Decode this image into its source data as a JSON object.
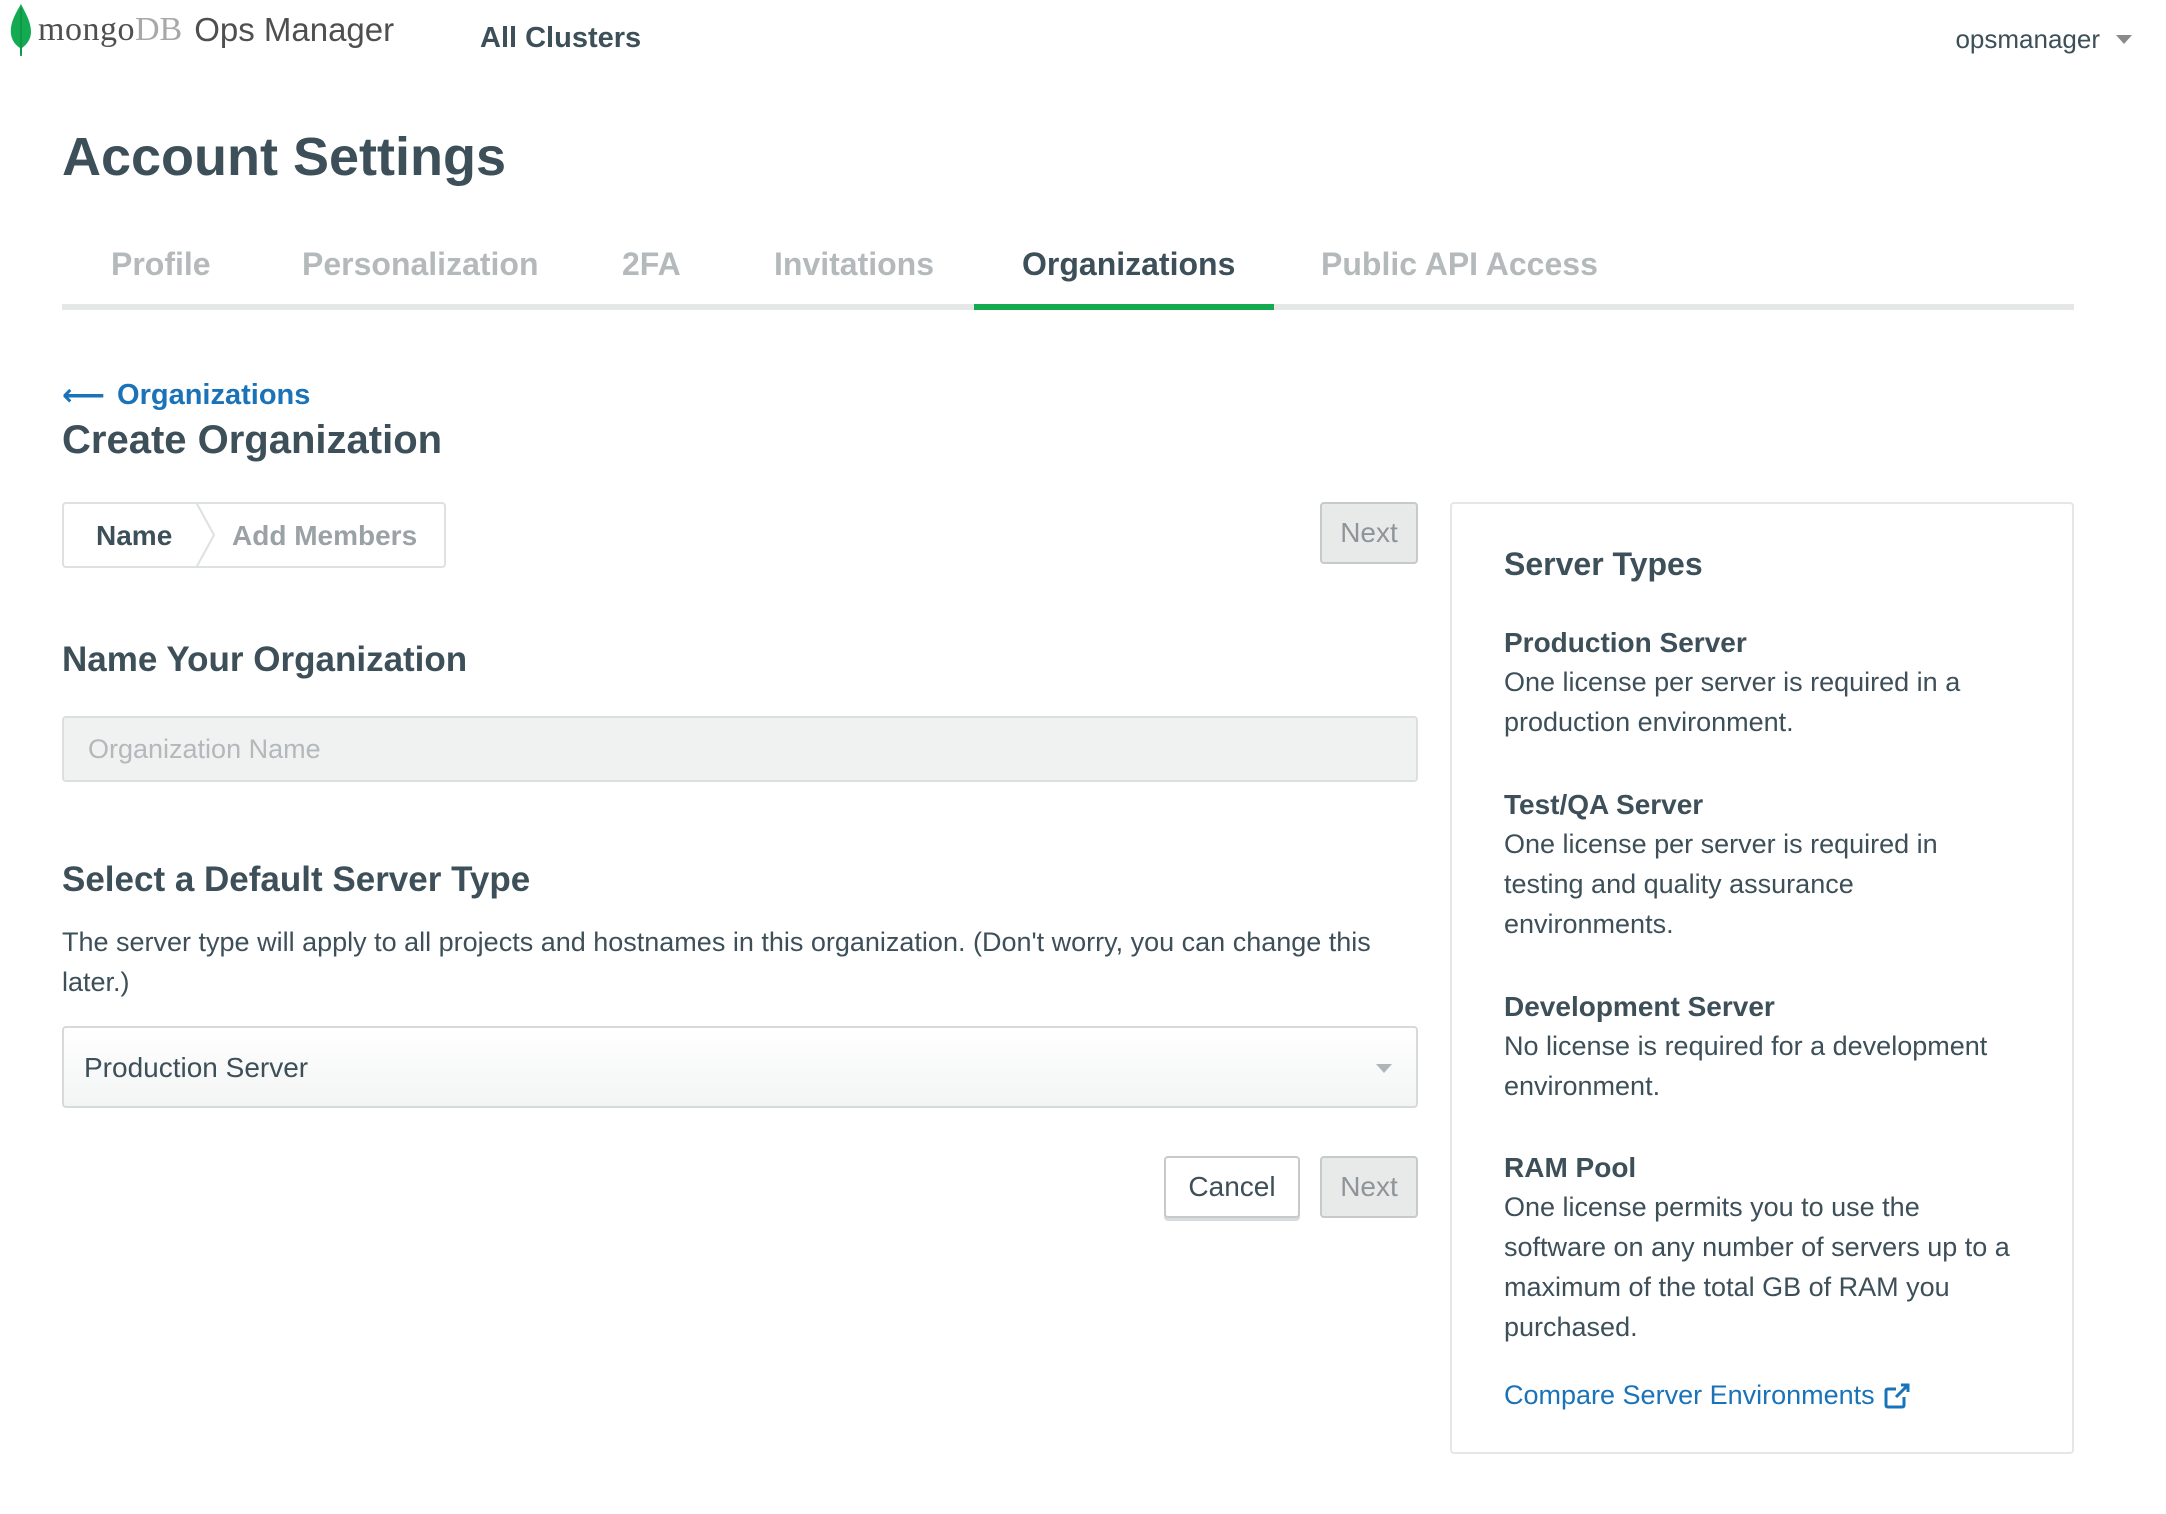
{
  "header": {
    "logo_mongo": "mongo",
    "logo_db": "DB",
    "logo_product": "Ops Manager",
    "nav_all_clusters": "All Clusters",
    "user_name": "opsmanager"
  },
  "page": {
    "title": "Account Settings"
  },
  "tabs": [
    {
      "label": "Profile"
    },
    {
      "label": "Personalization"
    },
    {
      "label": "2FA"
    },
    {
      "label": "Invitations"
    },
    {
      "label": "Organizations",
      "active": true
    },
    {
      "label": "Public API Access"
    }
  ],
  "breadcrumb": {
    "back_label": "Organizations"
  },
  "section": {
    "title": "Create Organization"
  },
  "stepper": {
    "steps": [
      {
        "label": "Name",
        "state": "current"
      },
      {
        "label": "Add Members",
        "state": "upcoming"
      }
    ]
  },
  "buttons": {
    "next_top": "Next",
    "cancel": "Cancel",
    "next_bottom": "Next"
  },
  "form": {
    "name_heading": "Name Your Organization",
    "name_placeholder": "Organization Name",
    "name_value": "",
    "server_heading": "Select a Default Server Type",
    "server_help": "The server type will apply to all projects and hostnames in this organization. (Don't worry, you can change this later.)",
    "server_selected": "Production Server"
  },
  "panel": {
    "title": "Server Types",
    "types": [
      {
        "name": "Production Server",
        "desc": "One license per server is required in a production environment."
      },
      {
        "name": "Test/QA Server",
        "desc": "One license per server is required in testing and quality assurance environments."
      },
      {
        "name": "Development Server",
        "desc": "No license is required for a development environment."
      },
      {
        "name": "RAM Pool",
        "desc": "One license permits you to use the software on any number of servers up to a maximum of the total GB of RAM you purchased."
      }
    ],
    "compare_link": "Compare Server Environments"
  },
  "colors": {
    "accent_green": "#13aa52",
    "link_blue": "#1a73b8",
    "text_dark": "#3d4f58",
    "tab_inactive": "#b4b9bb"
  },
  "icons": {
    "logo": "mongodb-leaf-icon",
    "user_menu": "caret-down-icon",
    "back": "arrow-left-icon",
    "select": "caret-down-icon",
    "external": "external-link-icon"
  }
}
